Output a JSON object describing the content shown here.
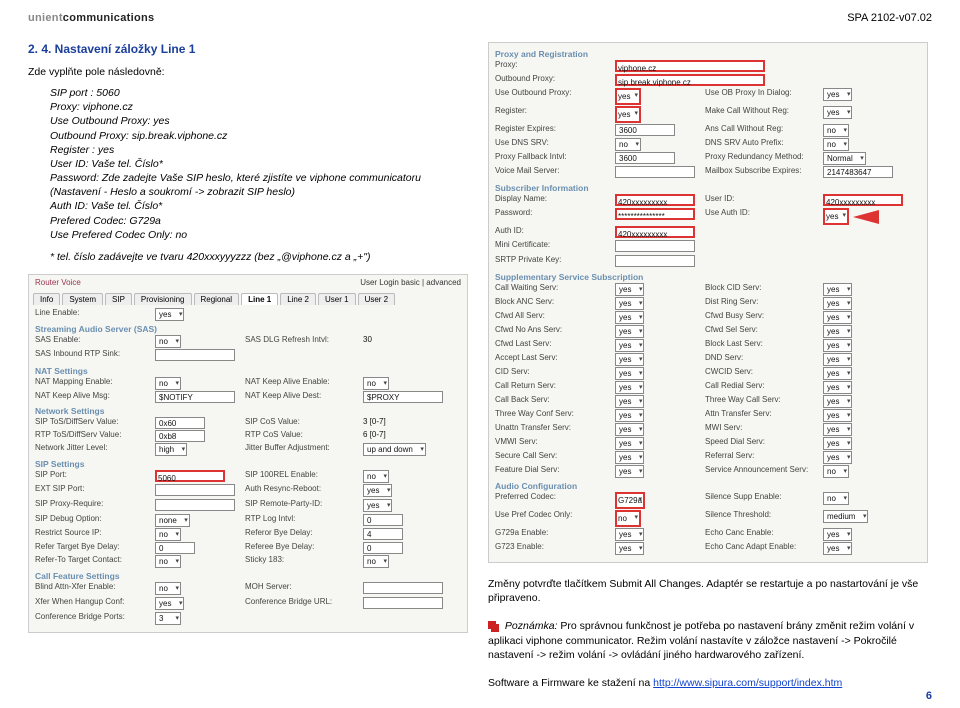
{
  "header": {
    "logo": "unientcommunications",
    "model": "SPA 2102-v07.02"
  },
  "left": {
    "title": "2. 4. Nastavení záložky Line 1",
    "intro": "Zde vyplňte pole následovně:",
    "lines": {
      "sip_port": "SIP port : 5060",
      "proxy": "Proxy: viphone.cz",
      "use_outbound": "Use Outbound Proxy: yes",
      "outbound_proxy": "Outbound Proxy: sip.break.viphone.cz",
      "register": "Register : yes",
      "user_id": "User ID: Vaše tel. Číslo*",
      "password": "Password: Zde zadejte Vaše SIP heslo, které zjistíte ve viphone communicatoru (Nastavení - Heslo a soukromí -> zobrazit SIP heslo)",
      "auth_id": "Auth ID: Vaše tel. Číslo*",
      "pref_codec": "Prefered Codec: G729a",
      "pref_codec_only": "Use Prefered Codec Only: no",
      "footnote": "* tel. číslo zadávejte ve tvaru 420xxxyyyzzz (bez „@viphone.cz a „+\")"
    },
    "panel": {
      "top_left": "Router          Voice",
      "top_right": "User Login   basic | advanced",
      "tabs1": [
        "Info",
        "System",
        "SIP",
        "Provisioning",
        "Regional",
        "Line 1",
        "Line 2",
        "User 1",
        "User 2"
      ],
      "active_tab": "Line 1",
      "rows": {
        "line_enable": {
          "k": "Line Enable:",
          "v": "yes"
        },
        "sas": "Streaming Audio Server (SAS)",
        "sas_enable": {
          "k": "SAS Enable:",
          "v": "no",
          "k2": "SAS DLG Refresh Intvl:",
          "v2": "30"
        },
        "sas_rtp": {
          "k": "SAS Inbound RTP Sink:",
          "v": ""
        },
        "nat": "NAT Settings",
        "nat_map": {
          "k": "NAT Mapping Enable:",
          "v": "no",
          "k2": "NAT Keep Alive Enable:",
          "v2": "no"
        },
        "nat_msg": {
          "k": "NAT Keep Alive Msg:",
          "v": "$NOTIFY",
          "k2": "NAT Keep Alive Dest:",
          "v2": "$PROXY"
        },
        "net": "Network Settings",
        "tos1": {
          "k": "SIP ToS/DiffServ Value:",
          "v": "0x60",
          "k2": "SIP CoS Value:",
          "v2": "3     [0-7]"
        },
        "tos2": {
          "k": "RTP ToS/DiffServ Value:",
          "v": "0xb8",
          "k2": "RTP CoS Value:",
          "v2": "6     [0-7]"
        },
        "jitter": {
          "k": "Network Jitter Level:",
          "v": "high",
          "k2": "Jitter Buffer Adjustment:",
          "v2": "up and down"
        },
        "sip": "SIP Settings",
        "sip_port_row": {
          "k": "SIP Port:",
          "v": "5060",
          "k2": "SIP 100REL Enable:",
          "v2": "no"
        },
        "ext_sip": {
          "k": "EXT SIP Port:",
          "v": "",
          "k2": "Auth Resync-Reboot:",
          "v2": "yes"
        },
        "proxy_req": {
          "k": "SIP Proxy-Require:",
          "v": "",
          "k2": "SIP Remote-Party-ID:",
          "v2": "yes"
        },
        "debug": {
          "k": "SIP Debug Option:",
          "v": "none",
          "k2": "RTP Log Intvl:",
          "v2": "0"
        },
        "restrict": {
          "k": "Restrict Source IP:",
          "v": "no",
          "k2": "Referor Bye Delay:",
          "v2": "4"
        },
        "target_bye": {
          "k": "Refer Target Bye Delay:",
          "v": "0",
          "k2": "Referee Bye Delay:",
          "v2": "0"
        },
        "refer_ee": {
          "k": "Refer-To Target Contact:",
          "v": "no",
          "k2": "Sticky 183:",
          "v2": "no"
        },
        "cfs": "Call Feature Settings",
        "blind": {
          "k": "Blind Attn-Xfer Enable:",
          "v": "no",
          "k2": "MOH Server:",
          "v2": ""
        },
        "xfer": {
          "k": "Xfer When Hangup Conf:",
          "v": "yes",
          "k2": "Conference Bridge URL:",
          "v2": ""
        },
        "conf": {
          "k": "Conference Bridge Ports:",
          "v": "3"
        }
      }
    }
  },
  "right": {
    "panel": {
      "pr": "Proxy and Registration",
      "proxy": {
        "k": "Proxy:",
        "v": "viphone.cz"
      },
      "out_proxy": {
        "k": "Outbound Proxy:",
        "v": "sip.break.viphone.cz"
      },
      "use_out": {
        "k": "Use Outbound Proxy:",
        "v": "yes",
        "k2": "Use OB Proxy In Dialog:",
        "v2": "yes"
      },
      "register": {
        "k": "Register:",
        "v": "yes",
        "k2": "Make Call Without Reg:",
        "v2": "yes"
      },
      "reg_exp": {
        "k": "Register Expires:",
        "v": "3600",
        "k2": "Ans Call Without Reg:",
        "v2": "no"
      },
      "dns_srv": {
        "k": "Use DNS SRV:",
        "v": "no",
        "k2": "DNS SRV Auto Prefix:",
        "v2": "no"
      },
      "fallback": {
        "k": "Proxy Fallback Intvl:",
        "v": "3600",
        "k2": "Proxy Redundancy Method:",
        "v2": "Normal"
      },
      "voicemail": {
        "k": "Voice Mail Server:",
        "v": "",
        "k2": "Mailbox Subscribe Expires:",
        "v2": "2147483647"
      },
      "si": "Subscriber Information",
      "display": {
        "k": "Display Name:",
        "v": "420xxxxxxxxx",
        "k2": "User ID:",
        "v2": "420xxxxxxxxx"
      },
      "password": {
        "k": "Password:",
        "v": "***************",
        "k2": "Use Auth ID:",
        "v2": "yes"
      },
      "auth": {
        "k": "Auth ID:",
        "v": "420xxxxxxxxx"
      },
      "mini": {
        "k": "Mini Certificate:",
        "v": ""
      },
      "srtp": {
        "k": "SRTP Private Key:",
        "v": ""
      },
      "sss": "Supplementary Service Subscription",
      "srv": [
        [
          "Call Waiting Serv:",
          "yes",
          "Block CID Serv:",
          "yes"
        ],
        [
          "Block ANC Serv:",
          "yes",
          "Dist Ring Serv:",
          "yes"
        ],
        [
          "Cfwd All Serv:",
          "yes",
          "Cfwd Busy Serv:",
          "yes"
        ],
        [
          "Cfwd No Ans Serv:",
          "yes",
          "Cfwd Sel Serv:",
          "yes"
        ],
        [
          "Cfwd Last Serv:",
          "yes",
          "Block Last Serv:",
          "yes"
        ],
        [
          "Accept Last Serv:",
          "yes",
          "DND Serv:",
          "yes"
        ],
        [
          "CID Serv:",
          "yes",
          "CWCID Serv:",
          "yes"
        ],
        [
          "Call Return Serv:",
          "yes",
          "Call Redial Serv:",
          "yes"
        ],
        [
          "Call Back Serv:",
          "yes",
          "Three Way Call Serv:",
          "yes"
        ],
        [
          "Three Way Conf Serv:",
          "yes",
          "Attn Transfer Serv:",
          "yes"
        ],
        [
          "Unattn Transfer Serv:",
          "yes",
          "MWI Serv:",
          "yes"
        ],
        [
          "VMWI Serv:",
          "yes",
          "Speed Dial Serv:",
          "yes"
        ],
        [
          "Secure Call Serv:",
          "yes",
          "Referral Serv:",
          "yes"
        ],
        [
          "Feature Dial Serv:",
          "yes",
          "Service Announcement Serv:",
          "no"
        ]
      ],
      "ac": "Audio Configuration",
      "pref_codec": {
        "k": "Preferred Codec:",
        "v": "G729a",
        "k2": "Silence Supp Enable:",
        "v2": "no"
      },
      "pref_only": {
        "k": "Use Pref Codec Only:",
        "v": "no",
        "k2": "Silence Threshold:",
        "v2": "medium"
      },
      "g729": {
        "k": "G729a Enable:",
        "v": "yes",
        "k2": "Echo Canc Enable:",
        "v2": "yes"
      },
      "g723": {
        "k": "G723 Enable:",
        "v": "yes",
        "k2": "Echo Canc Adapt Enable:",
        "v2": "yes"
      }
    },
    "text1": "Změny potvrďte tlačítkem Submit All Changes. Adaptér se restartuje a po nastartování je vše připraveno.",
    "note_label": "Poznámka:",
    "note_body": "Pro správnou funkčnost je potřeba po nastavení brány změnit režim volání v aplikaci viphone communicator. Režim volání nastavíte v záložce nastavení -> Pokročilé nastavení -> režim volání -> ovládání jiného hardwarového zařízení.",
    "software": "Software a Firmware ke stažení na ",
    "link": "http://www.sipura.com/support/index.htm"
  },
  "page_num": "6"
}
